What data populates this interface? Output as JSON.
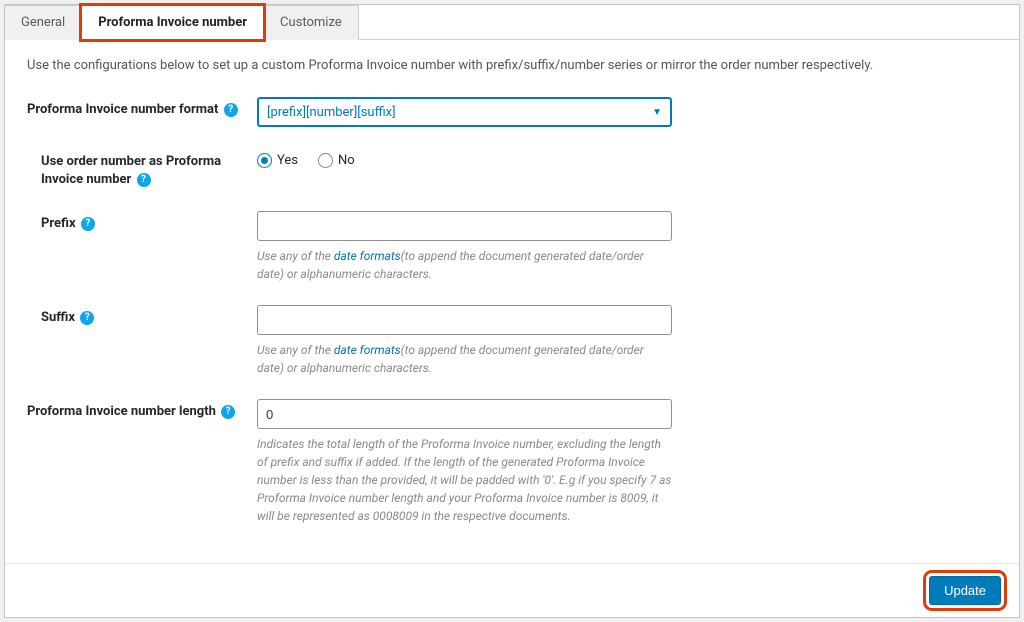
{
  "tabs": {
    "general": "General",
    "proforma": "Proforma Invoice number",
    "customize": "Customize"
  },
  "intro": "Use the configurations below to set up a custom Proforma Invoice number with prefix/suffix/number series or mirror the order number respectively.",
  "fields": {
    "format": {
      "label": "Proforma Invoice number format",
      "value": "[prefix][number][suffix]"
    },
    "use_order": {
      "label": "Use order number as Proforma Invoice number",
      "yes": "Yes",
      "no": "No"
    },
    "prefix": {
      "label": "Prefix",
      "value": "",
      "help1": "Use any of the ",
      "link": "date formats",
      "help2": "(to append the document generated date/order date) or alphanumeric characters."
    },
    "suffix": {
      "label": "Suffix",
      "value": "",
      "help1": "Use any of the ",
      "link": "date formats",
      "help2": "(to append the document generated date/order date) or alphanumeric characters."
    },
    "length": {
      "label": "Proforma Invoice number length",
      "value": "0",
      "help": "Indicates the total length of the Proforma Invoice number, excluding the length of prefix and suffix if added. If the length of the generated Proforma Invoice number is less than the provided, it will be padded with '0'. E.g if you specify 7 as Proforma Invoice number length and your Proforma Invoice number is 8009, it will be represented as 0008009 in the respective documents."
    }
  },
  "buttons": {
    "update": "Update"
  }
}
